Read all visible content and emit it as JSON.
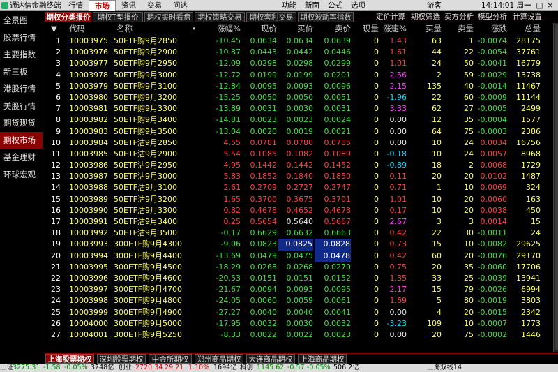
{
  "app": {
    "title": "通达信金融终端"
  },
  "menu": [
    "行情",
    "市场",
    "资讯",
    "交易",
    "问达"
  ],
  "rmenu": [
    "功能",
    "新面",
    "公式",
    "选项"
  ],
  "user": "游客",
  "clock": "14:14:01 周一",
  "win_buttons": "－□×",
  "left_nav": [
    "全景图",
    "股票行情",
    "主要指数",
    "新三板",
    "港股行情",
    "美股行情",
    "期货现货",
    "期权市场",
    "基金理财",
    "环球宏观"
  ],
  "tabs": [
    "期权分类报价",
    "期权T型报价",
    "期权实时看盘",
    "期权策略交易",
    "期权套利交易",
    "期权波动率指数"
  ],
  "right_tabs": [
    "定价计算",
    "期权筛选",
    "卖方分析",
    "模型分析",
    "计算设置"
  ],
  "header": {
    "sort": "▼",
    "code": "代码",
    "name": "名称",
    "dot": "•",
    "chg": "涨幅%",
    "price": "现价",
    "bid": "买价",
    "ask": "卖价",
    "vol": "现量",
    "spd": "涨速%",
    "bq": "买量",
    "sq": "卖量",
    "diff": "涨跌",
    "tot": "总量"
  },
  "rows": [
    [
      "1",
      "10003975",
      "50ETF购9月2850",
      "-10.45",
      "0.0634",
      "0.0634",
      "0.0639",
      "0",
      "1.43",
      "63",
      "1",
      "-0.0074",
      "28175"
    ],
    [
      "2",
      "10003976",
      "50ETF购9月2900",
      "-10.87",
      "0.0443",
      "0.0442",
      "0.0446",
      "0",
      "1.61",
      "44",
      "22",
      "-0.0054",
      "37761"
    ],
    [
      "3",
      "10003977",
      "50ETF购9月2950",
      "-12.09",
      "0.0298",
      "0.0298",
      "0.0299",
      "0",
      "1.01",
      "24",
      "50",
      "-0.0041",
      "16779"
    ],
    [
      "4",
      "10003978",
      "50ETF购9月3000",
      "-12.72",
      "0.0199",
      "0.0199",
      "0.0201",
      "0",
      "2.56",
      "2",
      "59",
      "-0.0029",
      "13738"
    ],
    [
      "5",
      "10003979",
      "50ETF购9月3100",
      "-12.84",
      "0.0095",
      "0.0093",
      "0.0096",
      "0",
      "2.15",
      "135",
      "40",
      "-0.0014",
      "11467"
    ],
    [
      "6",
      "10003980",
      "50ETF购9月3200",
      "-15.25",
      "0.0050",
      "0.0050",
      "0.0051",
      "0",
      "-1.96",
      "22",
      "60",
      "-0.0009",
      "11144"
    ],
    [
      "7",
      "10003981",
      "50ETF购9月3300",
      "-13.89",
      "0.0031",
      "0.0030",
      "0.0031",
      "0",
      "3.33",
      "62",
      "27",
      "-0.0005",
      "2499"
    ],
    [
      "8",
      "10003982",
      "50ETF购9月3400",
      "-14.81",
      "0.0023",
      "0.0023",
      "0.0024",
      "0",
      "0.00",
      "12",
      "35",
      "-0.0004",
      "1577"
    ],
    [
      "9",
      "10003983",
      "50ETF购9月3500",
      "-13.04",
      "0.0020",
      "0.0019",
      "0.0021",
      "0",
      "0.00",
      "64",
      "75",
      "-0.0003",
      "2386"
    ],
    [
      "10",
      "10003984",
      "50ETF沽9月2850",
      "4.55",
      "0.0781",
      "0.0780",
      "0.0785",
      "0",
      "0.00",
      "10",
      "24",
      "0.0034",
      "16756"
    ],
    [
      "11",
      "10003985",
      "50ETF沽9月2900",
      "5.54",
      "0.1085",
      "0.1082",
      "0.1089",
      "0",
      "-0.18",
      "10",
      "24",
      "0.0057",
      "8968"
    ],
    [
      "12",
      "10003986",
      "50ETF沽9月2950",
      "4.95",
      "0.1442",
      "0.1442",
      "0.1452",
      "0",
      "-0.89",
      "18",
      "2",
      "0.0068",
      "1729"
    ],
    [
      "13",
      "10003987",
      "50ETF沽9月3000",
      "5.83",
      "0.1852",
      "0.1840",
      "0.1850",
      "0",
      "0.11",
      "20",
      "20",
      "0.0102",
      "1487"
    ],
    [
      "14",
      "10003988",
      "50ETF沽9月3100",
      "2.61",
      "0.2709",
      "0.2727",
      "0.2747",
      "0",
      "0.71",
      "1",
      "10",
      "0.0069",
      "324"
    ],
    [
      "15",
      "10003989",
      "50ETF沽9月3200",
      "1.65",
      "0.3700",
      "0.3675",
      "0.3701",
      "0",
      "1.01",
      "10",
      "20",
      "0.0060",
      "163"
    ],
    [
      "16",
      "10003990",
      "50ETF沽9月3300",
      "0.82",
      "0.4678",
      "0.4652",
      "0.4678",
      "0",
      "0.17",
      "10",
      "20",
      "0.0038",
      "450"
    ],
    [
      "17",
      "10003991",
      "50ETF沽9月3400",
      "0.25",
      "0.5654",
      "0.5640",
      "0.5667",
      "0",
      "2.67",
      "3",
      "3",
      "0.0014",
      "15"
    ],
    [
      "18",
      "10003992",
      "50ETF沽9月3500",
      "-0.17",
      "0.6629",
      "0.6632",
      "0.6663",
      "0",
      "0.42",
      "22",
      "30",
      "-0.0011",
      "24"
    ],
    [
      "19",
      "10003993",
      "300ETF购9月4300",
      "-9.06",
      "0.0823",
      "0.0825",
      "0.0828",
      "0",
      "0.73",
      "15",
      "10",
      "-0.0082",
      "29625"
    ],
    [
      "20",
      "10003994",
      "300ETF购9月4400",
      "-13.69",
      "0.0479",
      "0.0475",
      "0.0478",
      "0",
      "0.42",
      "60",
      "20",
      "-0.0076",
      "29170"
    ],
    [
      "21",
      "10003995",
      "300ETF购9月4500",
      "-18.29",
      "0.0268",
      "0.0268",
      "0.0270",
      "0",
      "0.75",
      "20",
      "35",
      "-0.0060",
      "17706"
    ],
    [
      "22",
      "10003996",
      "300ETF购9月4600",
      "-20.53",
      "0.0151",
      "0.0151",
      "0.0152",
      "0",
      "1.35",
      "33",
      "25",
      "-0.0039",
      "13941"
    ],
    [
      "23",
      "10003997",
      "300ETF购9月4700",
      "-21.67",
      "0.0094",
      "0.0093",
      "0.0095",
      "0",
      "2.17",
      "15",
      "79",
      "-0.0026",
      "6994"
    ],
    [
      "24",
      "10003998",
      "300ETF购9月4800",
      "-24.05",
      "0.0060",
      "0.0059",
      "0.0061",
      "0",
      "1.69",
      "5",
      "80",
      "-0.0019",
      "3803"
    ],
    [
      "25",
      "10003999",
      "300ETF购9月4900",
      "-27.27",
      "0.0040",
      "0.0040",
      "0.0041",
      "0",
      "0.00",
      "4",
      "20",
      "-0.0015",
      "2342"
    ],
    [
      "26",
      "10004000",
      "300ETF购9月5000",
      "-17.95",
      "0.0032",
      "0.0030",
      "0.0032",
      "0",
      "-3.23",
      "109",
      "10",
      "-0.0007",
      "1773"
    ],
    [
      "27",
      "10004001",
      "300ETF购9月5250",
      "-8.33",
      "0.0022",
      "0.0022",
      "0.0023",
      "0",
      "0.00",
      "20",
      "75",
      "-0.0002",
      "1446"
    ]
  ],
  "bottom_tabs": [
    "上海股票期权",
    "深圳股票期权",
    "中金所期权",
    "郑州商品期权",
    "大连商品期权",
    "上海商品期权"
  ],
  "status": {
    "a": "上证",
    "b": "3275.31",
    "c": "-1.58",
    "d": "-0.05%",
    "e": "3248亿",
    "f": "创业",
    "g": "2720.34",
    "h": "29.21",
    "i": "1.10%",
    "j": "1694亿",
    "k": "科创",
    "l": "1145.62",
    "m": "-0.57",
    "n": "-0.05%",
    "o": "506.2亿",
    "p": "上海双线14"
  },
  "colors": {
    "up": "#ff4040",
    "down": "#40e040",
    "accent": "#8b0000"
  }
}
